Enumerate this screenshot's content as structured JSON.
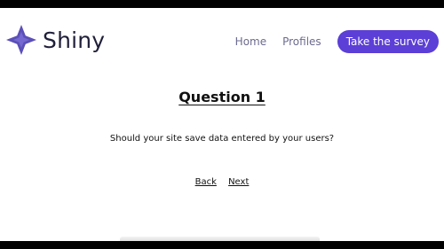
{
  "header": {
    "logo_text": "Shiny",
    "logo_icon": "sparkle-icon",
    "nav": [
      {
        "label": "Home"
      },
      {
        "label": "Profiles"
      }
    ],
    "cta_label": "Take the survey"
  },
  "question": {
    "title": "Question 1",
    "text": "Should your site save data entered by your users?"
  },
  "controls": {
    "back_label": "Back",
    "next_label": "Next"
  },
  "colors": {
    "accent": "#5b3fd6",
    "nav_text": "#6b6a8f",
    "logo_icon": "#5b4fb8"
  }
}
